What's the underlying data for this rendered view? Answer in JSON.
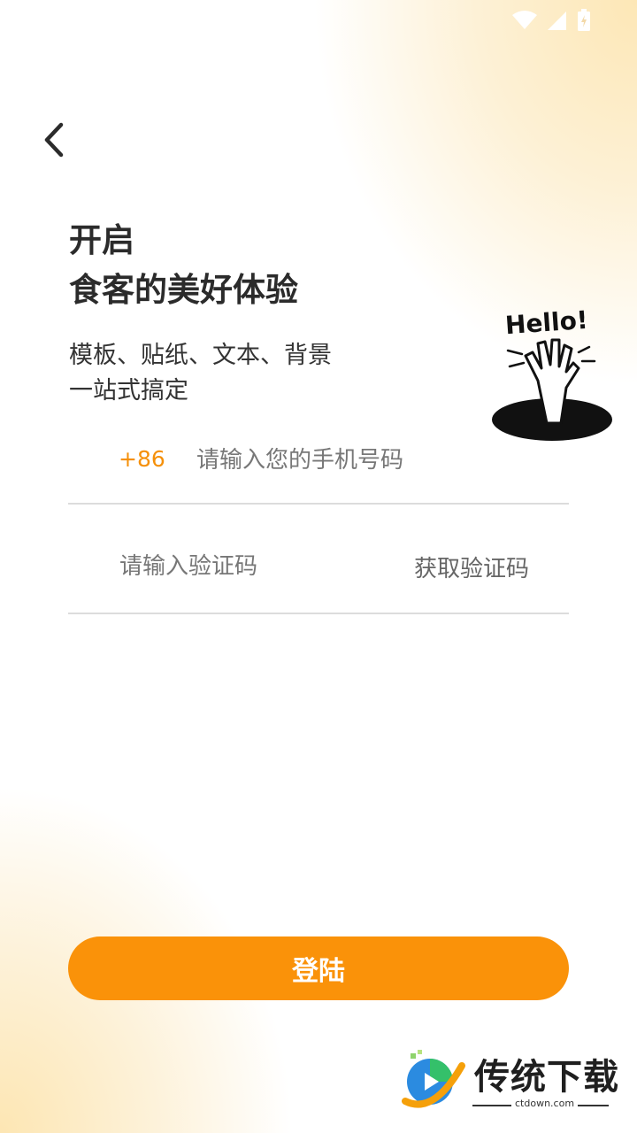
{
  "status_bar": {
    "icons": [
      "wifi-icon",
      "cell-signal-icon",
      "battery-icon"
    ]
  },
  "nav": {
    "back_icon": "chevron-left-icon"
  },
  "headline": {
    "line1": "开启",
    "line2": "食客的美好体验"
  },
  "subtitle": {
    "line1": "模板、贴纸、文本、背景",
    "line2": "一站式搞定"
  },
  "illustration": {
    "text": "Hello!",
    "name": "hello-hand-illustration"
  },
  "phone": {
    "country_code": "+86",
    "placeholder": "请输入您的手机号码",
    "value": ""
  },
  "code": {
    "placeholder": "请输入验证码",
    "value": "",
    "get_code_label": "获取验证码"
  },
  "login": {
    "label": "登陆"
  },
  "watermark": {
    "brand": "传统下载",
    "domain": "ctdown.com"
  },
  "colors": {
    "accent": "#fa9209",
    "text": "#2b2b2b",
    "divider": "#dcdcdc",
    "gradient": "#fde7b6"
  }
}
